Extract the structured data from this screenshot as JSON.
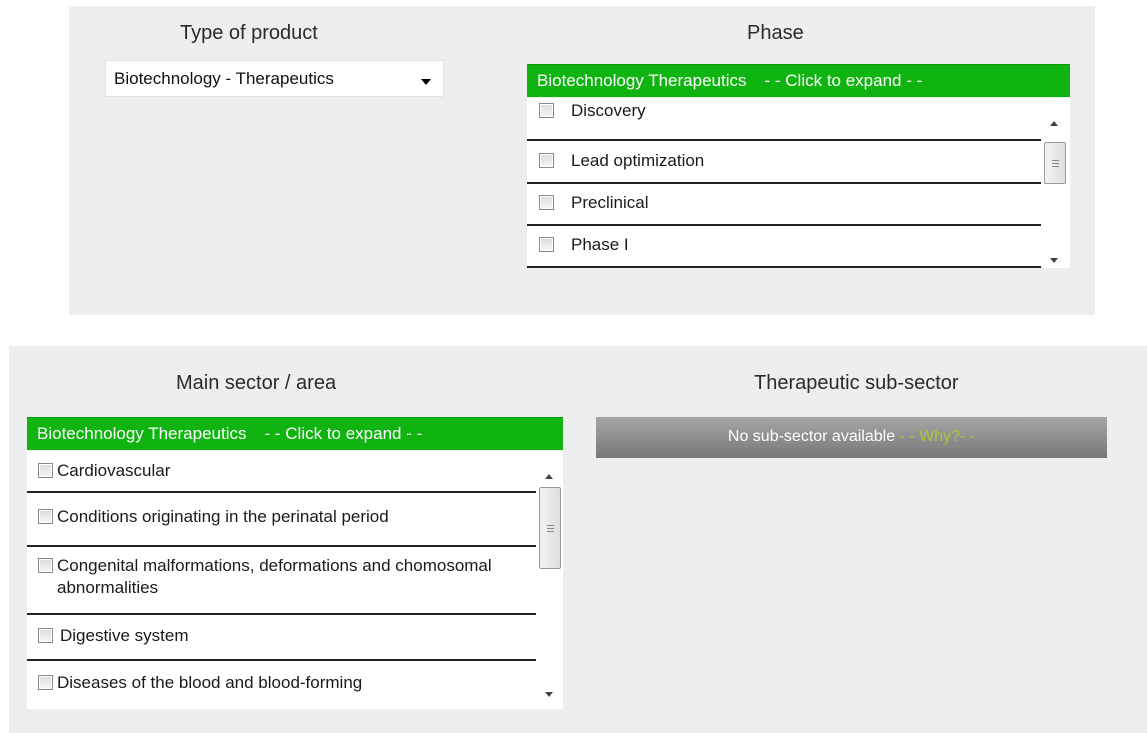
{
  "product_panel": {
    "title": "Type of product",
    "selected_value": "Biotechnology - Therapeutics"
  },
  "phase_panel": {
    "title": "Phase",
    "header_label": "Biotechnology Therapeutics",
    "expand_label": "- - Click to expand - -",
    "items": [
      {
        "label": "Discovery",
        "checked": false
      },
      {
        "label": "Lead optimization",
        "checked": false
      },
      {
        "label": "Preclinical",
        "checked": false
      },
      {
        "label": "Phase I",
        "checked": false
      }
    ]
  },
  "sector_panel": {
    "title": "Main sector / area",
    "header_label": "Biotechnology Therapeutics",
    "expand_label": "- - Click to expand - -",
    "items": [
      {
        "label": "Cardiovascular",
        "checked": false
      },
      {
        "label": "Conditions originating in the perinatal period",
        "checked": false
      },
      {
        "label": "Congenital malformations, deformations and chomosomal abnormalities",
        "checked": false
      },
      {
        "label": "Digestive system",
        "checked": false
      },
      {
        "label": "Diseases of the blood and blood-forming",
        "checked": false
      }
    ]
  },
  "subsector_panel": {
    "title": "Therapeutic sub-sector",
    "status_text": "No sub-sector available",
    "why_link": "- - Why?- -"
  },
  "colors": {
    "expand_header_green": "#10b410",
    "why_link_green": "#a3c93a",
    "panel_background": "#eeeeee"
  }
}
